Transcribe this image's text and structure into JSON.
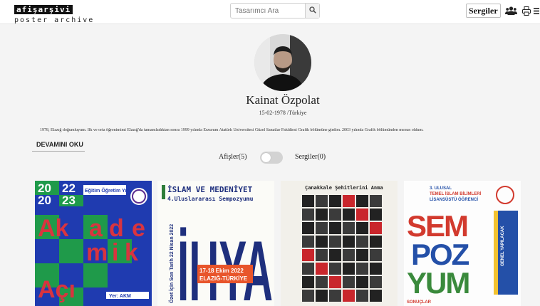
{
  "header": {
    "logo_main": "afişarşivi",
    "logo_sub": "poster archive",
    "search": {
      "placeholder": "Tasarımcı Ara",
      "icon": "search-icon"
    },
    "nav_button": "Sergiler",
    "icons": [
      "users-icon",
      "print-icon",
      "menu-icon"
    ]
  },
  "profile": {
    "name": "Kainat Özpolat",
    "birth": "15-02-1978 /Türkiye",
    "bio": "1978, Elazığ doğumluyum. İlk ve orta öğrenimimi Elazığ'da tamamladıktan sonra 1999 yılında Erzurum Atatürk Üniversitesi Güzel Sanatlar Fakültesi Grafik bölümüne girdim. 2003 yılında Grafik bölümünden mezun oldum.",
    "more_label": "DEVAMINI OKU"
  },
  "tabs": {
    "left": "Afişler(5)",
    "right": "Sergiler(0)",
    "toggle_on": false
  },
  "posters": [
    {
      "lines": [
        "20",
        "22",
        "20",
        "23",
        "Eğitim Öğretim Yılı",
        "Ak",
        "a",
        "d",
        "e",
        "m",
        "i",
        "k",
        "Açı",
        "Yer: AKM"
      ],
      "colors": {
        "blue": "#1f3bb0",
        "green": "#1f9a4a",
        "red": "#d9343f",
        "purple": "#5b2c8f"
      }
    },
    {
      "lines": [
        "İSLAM VE MEDENİYET",
        "4.Uluslararası Sempozyumu",
        "İHYA",
        "17-18 Ekim 2022",
        "ELAZIĞ-TÜRKİYE",
        "Özet İçin Son Tarih 22 Nisan 2022"
      ],
      "colors": {
        "navy": "#1e2f7d",
        "orange": "#e8552b",
        "green": "#2e7d3a"
      }
    },
    {
      "lines": [
        "Çanakkale Şehitlerini Anma"
      ],
      "colors": {
        "dark": "#222222",
        "red": "#c9262c"
      }
    },
    {
      "lines": [
        "3. ULUSAL",
        "TEMEL İSLAM BİLİMLERİ",
        "LİSANSÜSTÜ ÖĞRENCİ",
        "SEM",
        "POZ",
        "YUM",
        "SONUÇLAR",
        "GENEL YAPILACAK"
      ],
      "colors": {
        "blue": "#2450a8",
        "red": "#d23a2e",
        "yellow": "#f2c230",
        "green": "#3a8a3c"
      }
    }
  ]
}
